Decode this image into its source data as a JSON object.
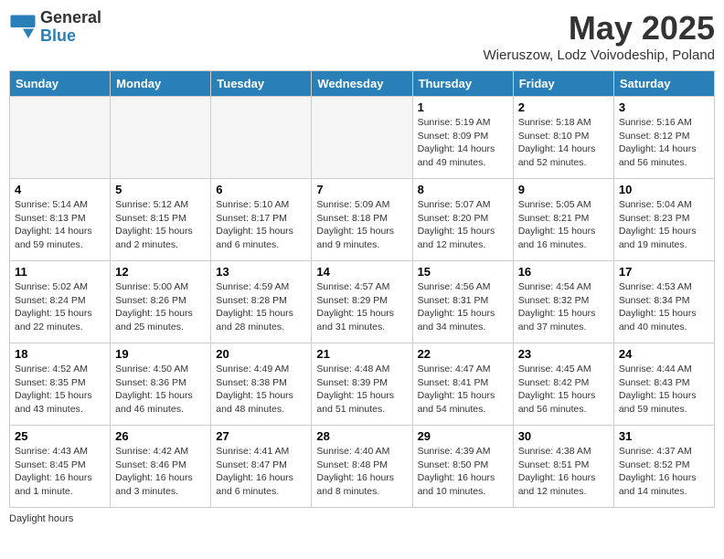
{
  "logo": {
    "general": "General",
    "blue": "Blue"
  },
  "title": "May 2025",
  "subtitle": "Wieruszow, Lodz Voivodeship, Poland",
  "days_of_week": [
    "Sunday",
    "Monday",
    "Tuesday",
    "Wednesday",
    "Thursday",
    "Friday",
    "Saturday"
  ],
  "weeks": [
    [
      {
        "num": "",
        "info": ""
      },
      {
        "num": "",
        "info": ""
      },
      {
        "num": "",
        "info": ""
      },
      {
        "num": "",
        "info": ""
      },
      {
        "num": "1",
        "info": "Sunrise: 5:19 AM\nSunset: 8:09 PM\nDaylight: 14 hours\nand 49 minutes."
      },
      {
        "num": "2",
        "info": "Sunrise: 5:18 AM\nSunset: 8:10 PM\nDaylight: 14 hours\nand 52 minutes."
      },
      {
        "num": "3",
        "info": "Sunrise: 5:16 AM\nSunset: 8:12 PM\nDaylight: 14 hours\nand 56 minutes."
      }
    ],
    [
      {
        "num": "4",
        "info": "Sunrise: 5:14 AM\nSunset: 8:13 PM\nDaylight: 14 hours\nand 59 minutes."
      },
      {
        "num": "5",
        "info": "Sunrise: 5:12 AM\nSunset: 8:15 PM\nDaylight: 15 hours\nand 2 minutes."
      },
      {
        "num": "6",
        "info": "Sunrise: 5:10 AM\nSunset: 8:17 PM\nDaylight: 15 hours\nand 6 minutes."
      },
      {
        "num": "7",
        "info": "Sunrise: 5:09 AM\nSunset: 8:18 PM\nDaylight: 15 hours\nand 9 minutes."
      },
      {
        "num": "8",
        "info": "Sunrise: 5:07 AM\nSunset: 8:20 PM\nDaylight: 15 hours\nand 12 minutes."
      },
      {
        "num": "9",
        "info": "Sunrise: 5:05 AM\nSunset: 8:21 PM\nDaylight: 15 hours\nand 16 minutes."
      },
      {
        "num": "10",
        "info": "Sunrise: 5:04 AM\nSunset: 8:23 PM\nDaylight: 15 hours\nand 19 minutes."
      }
    ],
    [
      {
        "num": "11",
        "info": "Sunrise: 5:02 AM\nSunset: 8:24 PM\nDaylight: 15 hours\nand 22 minutes."
      },
      {
        "num": "12",
        "info": "Sunrise: 5:00 AM\nSunset: 8:26 PM\nDaylight: 15 hours\nand 25 minutes."
      },
      {
        "num": "13",
        "info": "Sunrise: 4:59 AM\nSunset: 8:28 PM\nDaylight: 15 hours\nand 28 minutes."
      },
      {
        "num": "14",
        "info": "Sunrise: 4:57 AM\nSunset: 8:29 PM\nDaylight: 15 hours\nand 31 minutes."
      },
      {
        "num": "15",
        "info": "Sunrise: 4:56 AM\nSunset: 8:31 PM\nDaylight: 15 hours\nand 34 minutes."
      },
      {
        "num": "16",
        "info": "Sunrise: 4:54 AM\nSunset: 8:32 PM\nDaylight: 15 hours\nand 37 minutes."
      },
      {
        "num": "17",
        "info": "Sunrise: 4:53 AM\nSunset: 8:34 PM\nDaylight: 15 hours\nand 40 minutes."
      }
    ],
    [
      {
        "num": "18",
        "info": "Sunrise: 4:52 AM\nSunset: 8:35 PM\nDaylight: 15 hours\nand 43 minutes."
      },
      {
        "num": "19",
        "info": "Sunrise: 4:50 AM\nSunset: 8:36 PM\nDaylight: 15 hours\nand 46 minutes."
      },
      {
        "num": "20",
        "info": "Sunrise: 4:49 AM\nSunset: 8:38 PM\nDaylight: 15 hours\nand 48 minutes."
      },
      {
        "num": "21",
        "info": "Sunrise: 4:48 AM\nSunset: 8:39 PM\nDaylight: 15 hours\nand 51 minutes."
      },
      {
        "num": "22",
        "info": "Sunrise: 4:47 AM\nSunset: 8:41 PM\nDaylight: 15 hours\nand 54 minutes."
      },
      {
        "num": "23",
        "info": "Sunrise: 4:45 AM\nSunset: 8:42 PM\nDaylight: 15 hours\nand 56 minutes."
      },
      {
        "num": "24",
        "info": "Sunrise: 4:44 AM\nSunset: 8:43 PM\nDaylight: 15 hours\nand 59 minutes."
      }
    ],
    [
      {
        "num": "25",
        "info": "Sunrise: 4:43 AM\nSunset: 8:45 PM\nDaylight: 16 hours\nand 1 minute."
      },
      {
        "num": "26",
        "info": "Sunrise: 4:42 AM\nSunset: 8:46 PM\nDaylight: 16 hours\nand 3 minutes."
      },
      {
        "num": "27",
        "info": "Sunrise: 4:41 AM\nSunset: 8:47 PM\nDaylight: 16 hours\nand 6 minutes."
      },
      {
        "num": "28",
        "info": "Sunrise: 4:40 AM\nSunset: 8:48 PM\nDaylight: 16 hours\nand 8 minutes."
      },
      {
        "num": "29",
        "info": "Sunrise: 4:39 AM\nSunset: 8:50 PM\nDaylight: 16 hours\nand 10 minutes."
      },
      {
        "num": "30",
        "info": "Sunrise: 4:38 AM\nSunset: 8:51 PM\nDaylight: 16 hours\nand 12 minutes."
      },
      {
        "num": "31",
        "info": "Sunrise: 4:37 AM\nSunset: 8:52 PM\nDaylight: 16 hours\nand 14 minutes."
      }
    ]
  ],
  "footer": {
    "daylight_label": "Daylight hours"
  }
}
